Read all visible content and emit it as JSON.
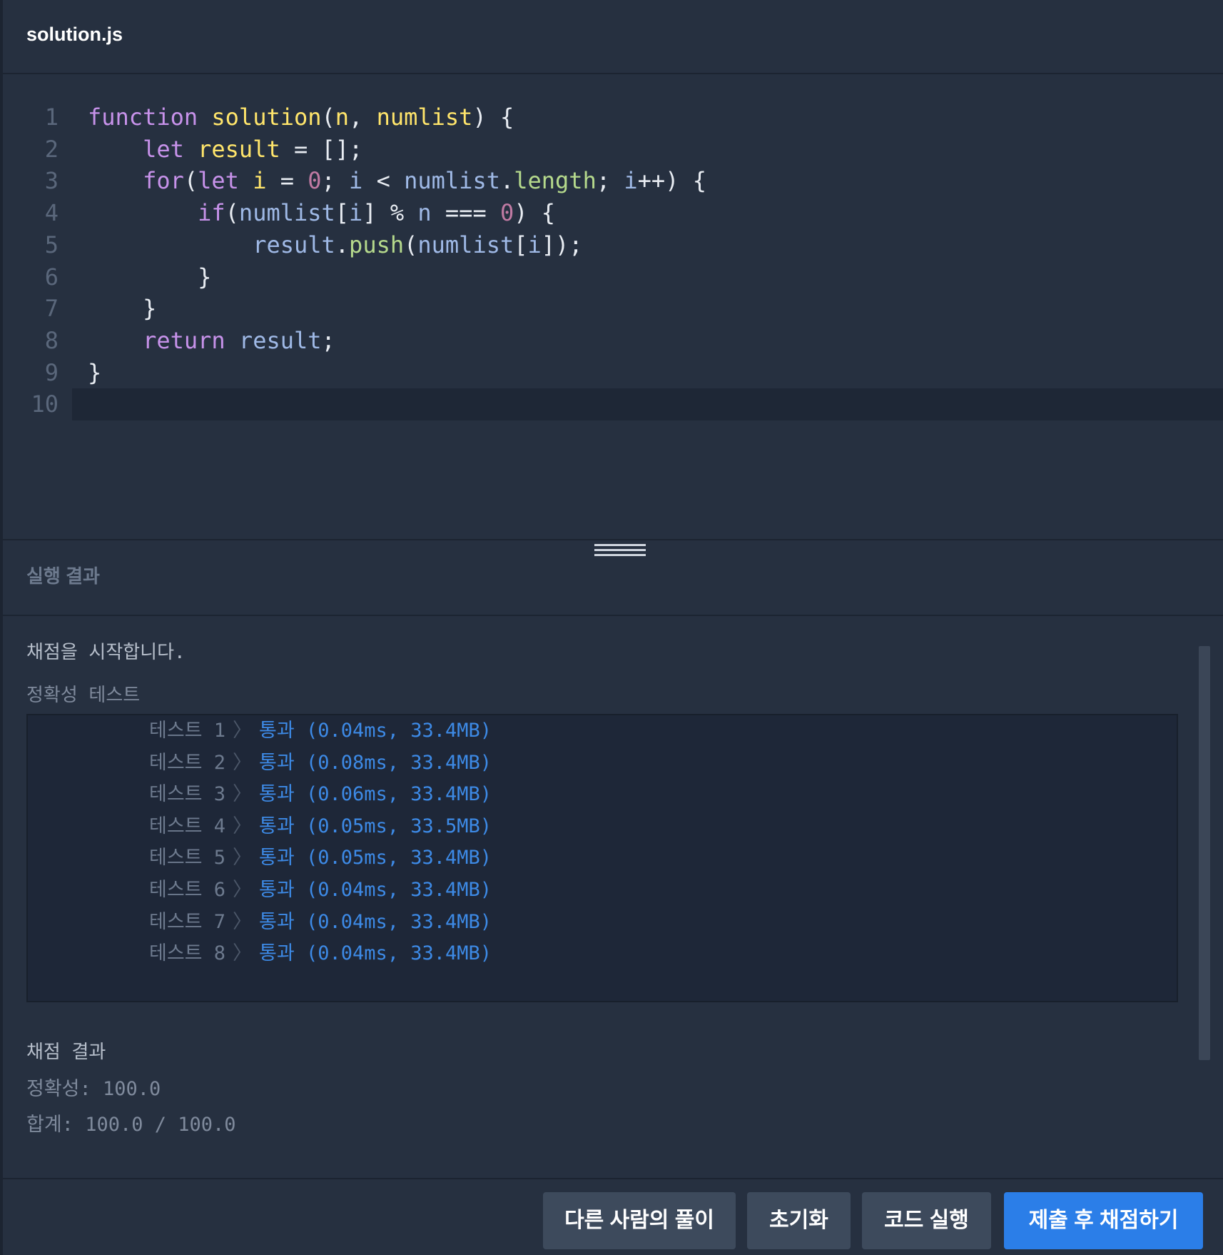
{
  "header": {
    "file_name": "solution.js"
  },
  "editor": {
    "lines": [
      {
        "n": "1"
      },
      {
        "n": "2"
      },
      {
        "n": "3"
      },
      {
        "n": "4"
      },
      {
        "n": "5"
      },
      {
        "n": "6"
      },
      {
        "n": "7"
      },
      {
        "n": "8"
      },
      {
        "n": "9"
      },
      {
        "n": "10"
      }
    ],
    "code": [
      [
        [
          "kw",
          "function"
        ],
        [
          "plain",
          " "
        ],
        [
          "fn",
          "solution"
        ],
        [
          "plain",
          "("
        ],
        [
          "var",
          "n"
        ],
        [
          "plain",
          ", "
        ],
        [
          "var",
          "numlist"
        ],
        [
          "plain",
          ") {"
        ]
      ],
      [
        [
          "plain",
          "    "
        ],
        [
          "kw",
          "let"
        ],
        [
          "plain",
          " "
        ],
        [
          "var",
          "result"
        ],
        [
          "plain",
          " = [];"
        ]
      ],
      [
        [
          "plain",
          "    "
        ],
        [
          "kw",
          "for"
        ],
        [
          "plain",
          "("
        ],
        [
          "kw",
          "let"
        ],
        [
          "plain",
          " "
        ],
        [
          "var",
          "i"
        ],
        [
          "plain",
          " = "
        ],
        [
          "num",
          "0"
        ],
        [
          "plain",
          "; "
        ],
        [
          "id",
          "i"
        ],
        [
          "plain",
          " < "
        ],
        [
          "id",
          "numlist"
        ],
        [
          "plain",
          "."
        ],
        [
          "prop",
          "length"
        ],
        [
          "plain",
          "; "
        ],
        [
          "id",
          "i"
        ],
        [
          "plain",
          "++) {"
        ]
      ],
      [
        [
          "plain",
          "        "
        ],
        [
          "kw",
          "if"
        ],
        [
          "plain",
          "("
        ],
        [
          "id",
          "numlist"
        ],
        [
          "plain",
          "["
        ],
        [
          "id",
          "i"
        ],
        [
          "plain",
          "] % "
        ],
        [
          "id",
          "n"
        ],
        [
          "plain",
          " === "
        ],
        [
          "num",
          "0"
        ],
        [
          "plain",
          ") {"
        ]
      ],
      [
        [
          "plain",
          "            "
        ],
        [
          "id",
          "result"
        ],
        [
          "plain",
          "."
        ],
        [
          "meth",
          "push"
        ],
        [
          "plain",
          "("
        ],
        [
          "id",
          "numlist"
        ],
        [
          "plain",
          "["
        ],
        [
          "id",
          "i"
        ],
        [
          "plain",
          "]);"
        ]
      ],
      [
        [
          "plain",
          "        }"
        ]
      ],
      [
        [
          "plain",
          "    }"
        ]
      ],
      [
        [
          "plain",
          "    "
        ],
        [
          "kw",
          "return"
        ],
        [
          "plain",
          " "
        ],
        [
          "id",
          "result"
        ],
        [
          "plain",
          ";"
        ]
      ],
      [
        [
          "plain",
          "}"
        ]
      ],
      []
    ]
  },
  "results": {
    "title": "실행 결과",
    "grading_start": "채점을 시작합니다.",
    "section_label": "정확성  테스트",
    "tests": [
      {
        "label": "테스트 1",
        "arrow": "〉",
        "result": "통과 (0.04ms, 33.4MB)"
      },
      {
        "label": "테스트 2",
        "arrow": "〉",
        "result": "통과 (0.08ms, 33.4MB)"
      },
      {
        "label": "테스트 3",
        "arrow": "〉",
        "result": "통과 (0.06ms, 33.4MB)"
      },
      {
        "label": "테스트 4",
        "arrow": "〉",
        "result": "통과 (0.05ms, 33.5MB)"
      },
      {
        "label": "테스트 5",
        "arrow": "〉",
        "result": "통과 (0.05ms, 33.4MB)"
      },
      {
        "label": "테스트 6",
        "arrow": "〉",
        "result": "통과 (0.04ms, 33.4MB)"
      },
      {
        "label": "테스트 7",
        "arrow": "〉",
        "result": "통과 (0.04ms, 33.4MB)"
      },
      {
        "label": "테스트 8",
        "arrow": "〉",
        "result": "통과 (0.04ms, 33.4MB)"
      }
    ],
    "score_title": "채점 결과",
    "accuracy": "정확성: 100.0",
    "total": "합계: 100.0 / 100.0"
  },
  "footer": {
    "others_solution": "다른 사람의 풀이",
    "reset": "초기화",
    "run_code": "코드 실행",
    "submit": "제출 후 채점하기"
  }
}
